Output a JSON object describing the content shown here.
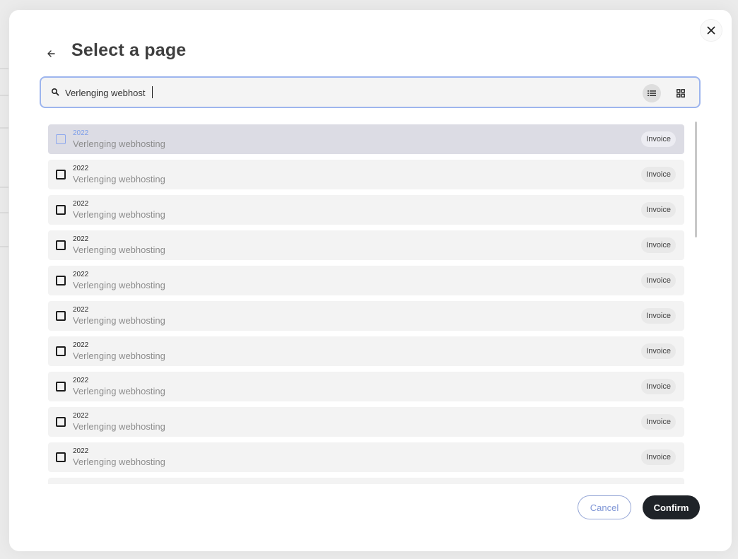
{
  "dialog": {
    "title": "Select a page",
    "close_icon": "close-icon",
    "back_icon": "arrow-left-icon"
  },
  "search": {
    "value": "Verlenging webhost",
    "icon": "search-icon",
    "view_modes": [
      "list-view-icon",
      "grid-view-icon"
    ],
    "active_view": "list"
  },
  "results": [
    {
      "year": "2022",
      "name": "Verlenging webhosting",
      "badge": "Invoice",
      "highlighted": true,
      "checked": false
    },
    {
      "year": "2022",
      "name": "Verlenging webhosting",
      "badge": "Invoice",
      "highlighted": false,
      "checked": false
    },
    {
      "year": "2022",
      "name": "Verlenging webhosting",
      "badge": "Invoice",
      "highlighted": false,
      "checked": false
    },
    {
      "year": "2022",
      "name": "Verlenging webhosting",
      "badge": "Invoice",
      "highlighted": false,
      "checked": false
    },
    {
      "year": "2022",
      "name": "Verlenging webhosting",
      "badge": "Invoice",
      "highlighted": false,
      "checked": false
    },
    {
      "year": "2022",
      "name": "Verlenging webhosting",
      "badge": "Invoice",
      "highlighted": false,
      "checked": false
    },
    {
      "year": "2022",
      "name": "Verlenging webhosting",
      "badge": "Invoice",
      "highlighted": false,
      "checked": false
    },
    {
      "year": "2022",
      "name": "Verlenging webhosting",
      "badge": "Invoice",
      "highlighted": false,
      "checked": false
    },
    {
      "year": "2022",
      "name": "Verlenging webhosting",
      "badge": "Invoice",
      "highlighted": false,
      "checked": false
    },
    {
      "year": "2022",
      "name": "Verlenging webhosting",
      "badge": "Invoice",
      "highlighted": false,
      "checked": false
    }
  ],
  "footer": {
    "cancel_label": "Cancel",
    "confirm_label": "Confirm"
  },
  "colors": {
    "accent": "#9db5ee",
    "highlight_row": "#dcdce4",
    "confirm_bg": "#1f2328"
  }
}
